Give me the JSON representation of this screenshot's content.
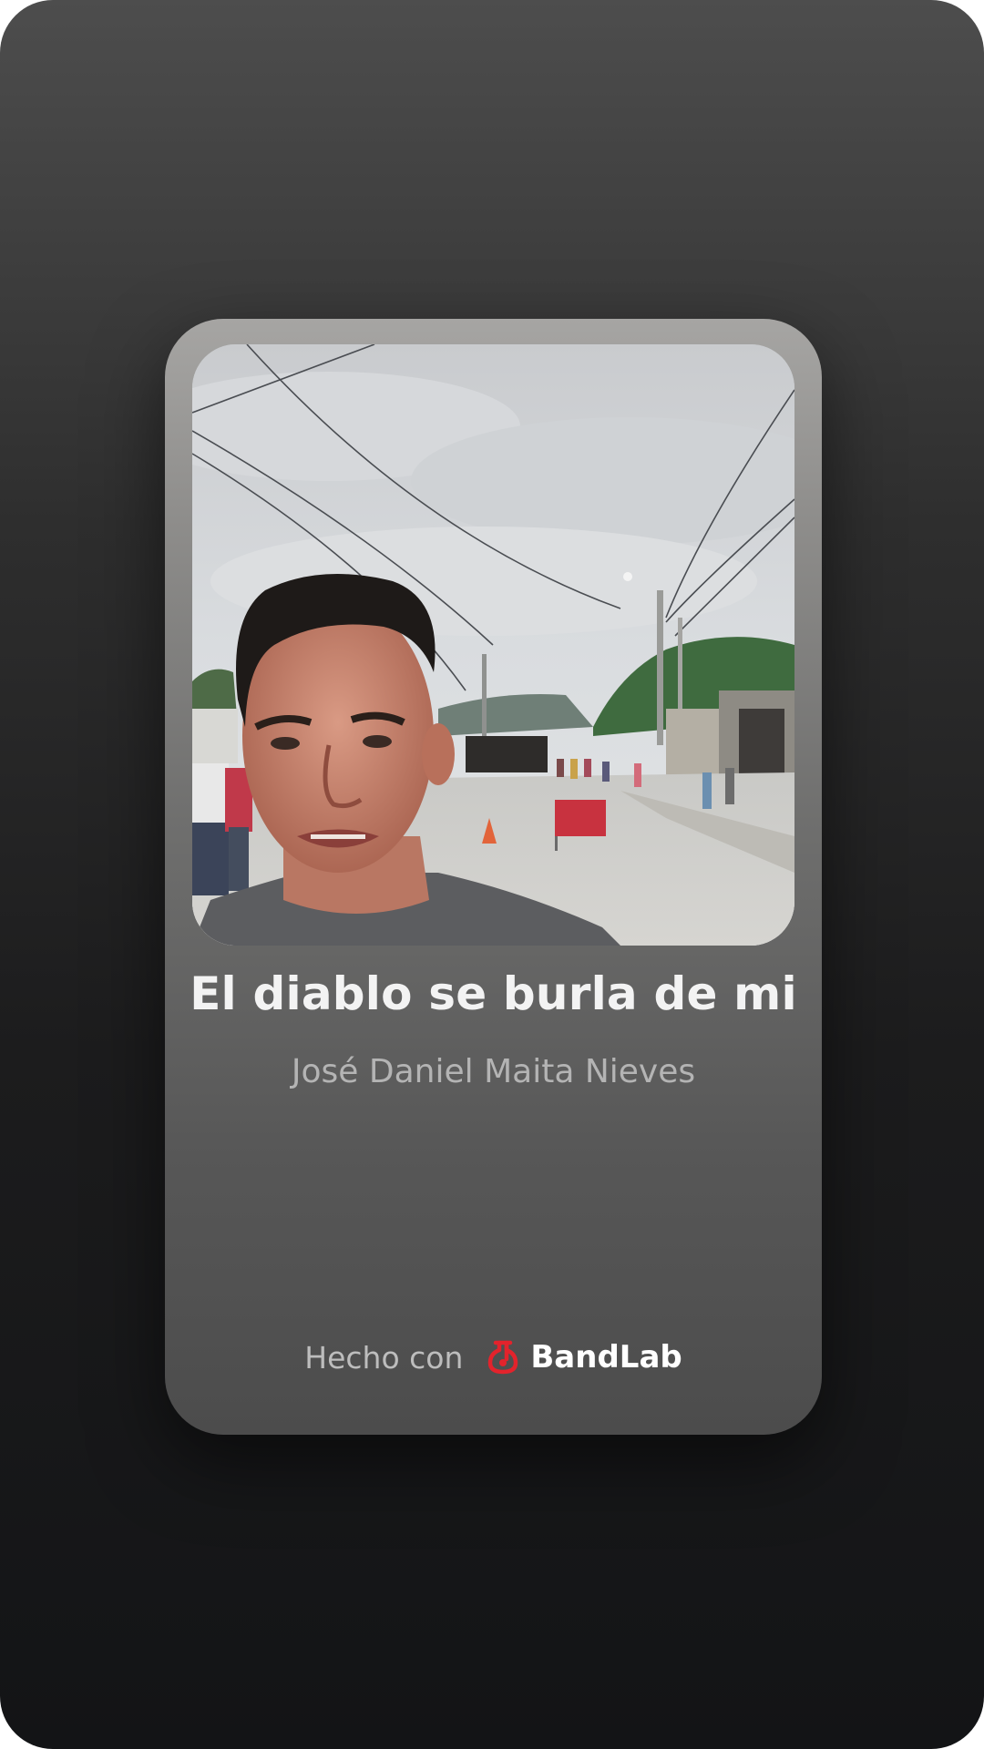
{
  "track": {
    "title": "El diablo se burla de mi",
    "artist": "José Daniel Maita Nieves"
  },
  "footer": {
    "made_with": "Hecho con",
    "brand": "BandLab"
  },
  "colors": {
    "brand_red": "#e3232c",
    "title_text": "#f3f3f3",
    "artist_text": "#b4b4b4"
  },
  "icons": {
    "brand_logo": "bandlab-logo-icon"
  }
}
